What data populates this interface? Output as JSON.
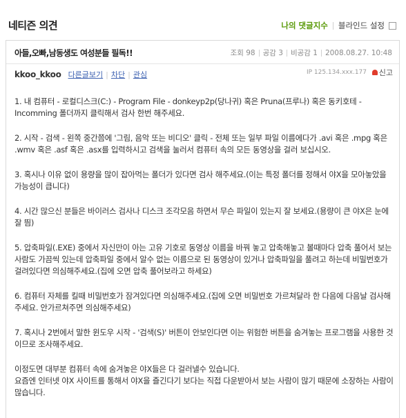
{
  "header": {
    "title": "네티즌 의견",
    "my_comments_label": "나의 댓글지수",
    "blind_setting_label": "블라인드 설정"
  },
  "post": {
    "title": "아들,오빠,남동생도 여성분들 필독!!",
    "views": "조회 98",
    "likes": "공감 3",
    "dislikes": "비공감 1",
    "datetime": "2008.08.27. 10:48",
    "author": "kkoo_kkoo",
    "author_links": [
      "다른글보기",
      "차단",
      "관심"
    ],
    "ip": "IP 125.134.xxx.177",
    "report_label": "신고",
    "paragraphs": [
      "1. 내 컴퓨터 - 로컬디스크(C:) - Program File - donkeyp2p(당나귀) 혹은 Pruna(프루나) 혹은 동키호테 - Incomming 폴더까지 클릭해서 검사 한번 해주세요.",
      "2. 시작 - 검색 - 왼쪽 중간쯤에 '그림, 음악 또는 비디오' 클릭 - 전체 또는 일부 파일 이름에다가 .avi 혹은 .mpg 혹은 .wmv 혹은 .asf 혹은 .asx를 입력하시고 검색을 눌러서 컴퓨터 속의 모든 동영상을 걸러 보십시오.",
      "3. 혹시나 이유 없이 용량을 많이 잡아먹는 폴더가 있다면 검사 해주세요.(이는 특정 폴더를 정해서 야X을 모아놓았을 가능성이 큽니다)",
      "4. 시간 많으신 분들은 바이러스 검사나 디스크 조각모음 하면서 무슨 파일이 있는지 잘 보세요.(용량이 큰 야X은 눈에 잘 띔)",
      "5. 압축파일(.EXE) 중에서 자신만이 아는 고유 기호로 동영상 이름을 바꿔 놓고 압축해놓고 볼때마다 압축 풀어서 보는 사람도 가끔씩 있는데 압축파일 중에서 알수 없는 이름으로 된 동영상이 있거나 압축파일을 풀려고 하는데 비밀번호가 걸려있다면 의심해주세요.(집에 오면 압축 풀어보라고 하세요)",
      "6. 컴퓨터 자체를 킬때 비밀번호가 잠겨있다면 의심해주세요.(집에 오면 비밀번호 가르쳐달라 한 다음에 다음날 검사해주세요. 안가르쳐주면 의심해주세요)",
      "7. 혹시나 2번에서 말한 윈도우 시작 - '검색(S)' 버튼이 안보인다면 이는 위험한 버튼을 숨겨놓는 프로그램을 사용한 것이므로 조사해주세요.",
      "이정도면 대부분 컴퓨터 속에 숨겨놓은 야X들은 다 걸러낼수 있습니다.\n요즘엔 인터넷 야X 사이트를 통해서 야X을 즐긴다기 보다는 직접 다운받아서 보는 사람이 많기 때문에 소장하는 사람이 많습니다."
    ]
  },
  "colors": {
    "accent_green": "#5a9a08",
    "link_blue": "#3a5fb0",
    "report_red": "#e03c2c"
  }
}
